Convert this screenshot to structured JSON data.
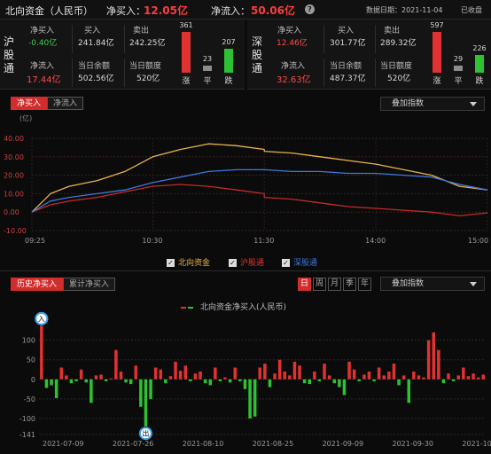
{
  "header": {
    "title": "北向资金（人民币）",
    "net_buy_label": "净买入：",
    "net_buy_value": "12.05亿",
    "net_inflow_label": "净流入：",
    "net_inflow_value": "50.06亿",
    "data_date": "数据日期：2021-11-04",
    "status": "已收盘"
  },
  "sh": {
    "label": "沪股通",
    "net_buy_label": "净买入",
    "net_buy": "-0.40亿",
    "buy_label": "买入",
    "buy": "241.84亿",
    "sell_label": "卖出",
    "sell": "242.25亿",
    "net_inflow_label": "净流入",
    "net_inflow": "17.44亿",
    "balance_label": "当日余额",
    "balance": "502.56亿",
    "quota_label": "当日额度",
    "quota": "520亿",
    "up": "361",
    "flat": "23",
    "down": "207",
    "up_label": "涨",
    "flat_label": "平",
    "down_label": "跌"
  },
  "sz": {
    "label": "深股通",
    "net_buy_label": "净买入",
    "net_buy": "12.46亿",
    "buy_label": "买入",
    "buy": "301.77亿",
    "sell_label": "卖出",
    "sell": "289.32亿",
    "net_inflow_label": "净流入",
    "net_inflow": "32.63亿",
    "balance_label": "当日余额",
    "balance": "487.37亿",
    "quota_label": "当日额度",
    "quota": "520亿",
    "up": "597",
    "flat": "29",
    "down": "226",
    "up_label": "涨",
    "flat_label": "平",
    "down_label": "跌"
  },
  "intraday": {
    "tabs": [
      "净买入",
      "净流入"
    ],
    "overlay": "叠加指数",
    "legend": [
      "北向资金",
      "沪股通",
      "深股通"
    ]
  },
  "history": {
    "tabs": [
      "历史净买入",
      "累计净买入"
    ],
    "periods": [
      "日",
      "周",
      "月",
      "季",
      "年"
    ],
    "overlay": "叠加指数",
    "legend": "北向资金净买入(人民币)",
    "markers": {
      "in": "入",
      "out": "出"
    }
  },
  "colors": {
    "red": "#e03232",
    "green": "#2ec133",
    "gold": "#e8b34b",
    "blue": "#3f78d8",
    "crimson": "#c42a2a"
  },
  "chart_data": [
    {
      "type": "line",
      "title": "",
      "ylabel": "(亿)",
      "ylim": [
        -10,
        40
      ],
      "yticks": [
        "40.00",
        "30.00",
        "20.00",
        "10.00",
        "0.00",
        "-10.00"
      ],
      "x_ticks": [
        "09:25",
        "10:30",
        "11:30",
        "14:00",
        "15:00"
      ],
      "x": [
        "09:25",
        "09:35",
        "09:45",
        "10:00",
        "10:15",
        "10:30",
        "10:45",
        "11:00",
        "11:15",
        "11:30",
        "13:00",
        "13:15",
        "13:30",
        "13:45",
        "14:00",
        "14:15",
        "14:30",
        "14:45",
        "15:00"
      ],
      "series": [
        {
          "name": "北向资金",
          "color": "#e8b34b",
          "values": [
            0,
            10,
            14,
            17,
            22,
            30,
            34,
            37,
            36,
            34,
            33,
            32,
            30,
            28,
            26,
            23,
            20,
            14,
            12
          ]
        },
        {
          "name": "沪股通",
          "color": "#c42a2a",
          "values": [
            0,
            4,
            6,
            8,
            11,
            14,
            15,
            14,
            12,
            10,
            8,
            7,
            5,
            3,
            2,
            1,
            0,
            -2,
            -0.4
          ]
        },
        {
          "name": "深股通",
          "color": "#3f78d8",
          "values": [
            0,
            6,
            8,
            10,
            12,
            16,
            19,
            22,
            23,
            23,
            23,
            22,
            22,
            21,
            21,
            20,
            19,
            15,
            12
          ]
        }
      ]
    },
    {
      "type": "bar",
      "title": "",
      "series_name": "北向资金净买入(人民币)",
      "ylim": [
        -141,
        140
      ],
      "yticks": [
        "100",
        "50",
        "0",
        "-50",
        "-100",
        "-141"
      ],
      "x_ticks": [
        "2021-07-09",
        "2021-07-26",
        "2021-08-10",
        "2021-08-25",
        "2021-09-09",
        "2021-09-30",
        "2021-10-26"
      ],
      "values": [
        137,
        -22,
        -15,
        -48,
        30,
        10,
        -10,
        -5,
        25,
        -8,
        -60,
        10,
        12,
        -5,
        2,
        75,
        20,
        -8,
        -12,
        35,
        -70,
        -120,
        -50,
        30,
        25,
        -10,
        8,
        45,
        22,
        35,
        -5,
        15,
        20,
        -10,
        -15,
        30,
        -5,
        5,
        -8,
        30,
        -5,
        -25,
        -100,
        -95,
        30,
        40,
        -20,
        15,
        50,
        20,
        10,
        45,
        35,
        -10,
        -12,
        20,
        -5,
        40,
        10,
        -10,
        -20,
        -40,
        45,
        25,
        -5,
        12,
        20,
        -5,
        30,
        10,
        20,
        40,
        -15,
        10,
        -60,
        20,
        10,
        5,
        100,
        120,
        75,
        -10,
        15,
        -5,
        10,
        30,
        8,
        15,
        5,
        12
      ]
    }
  ]
}
